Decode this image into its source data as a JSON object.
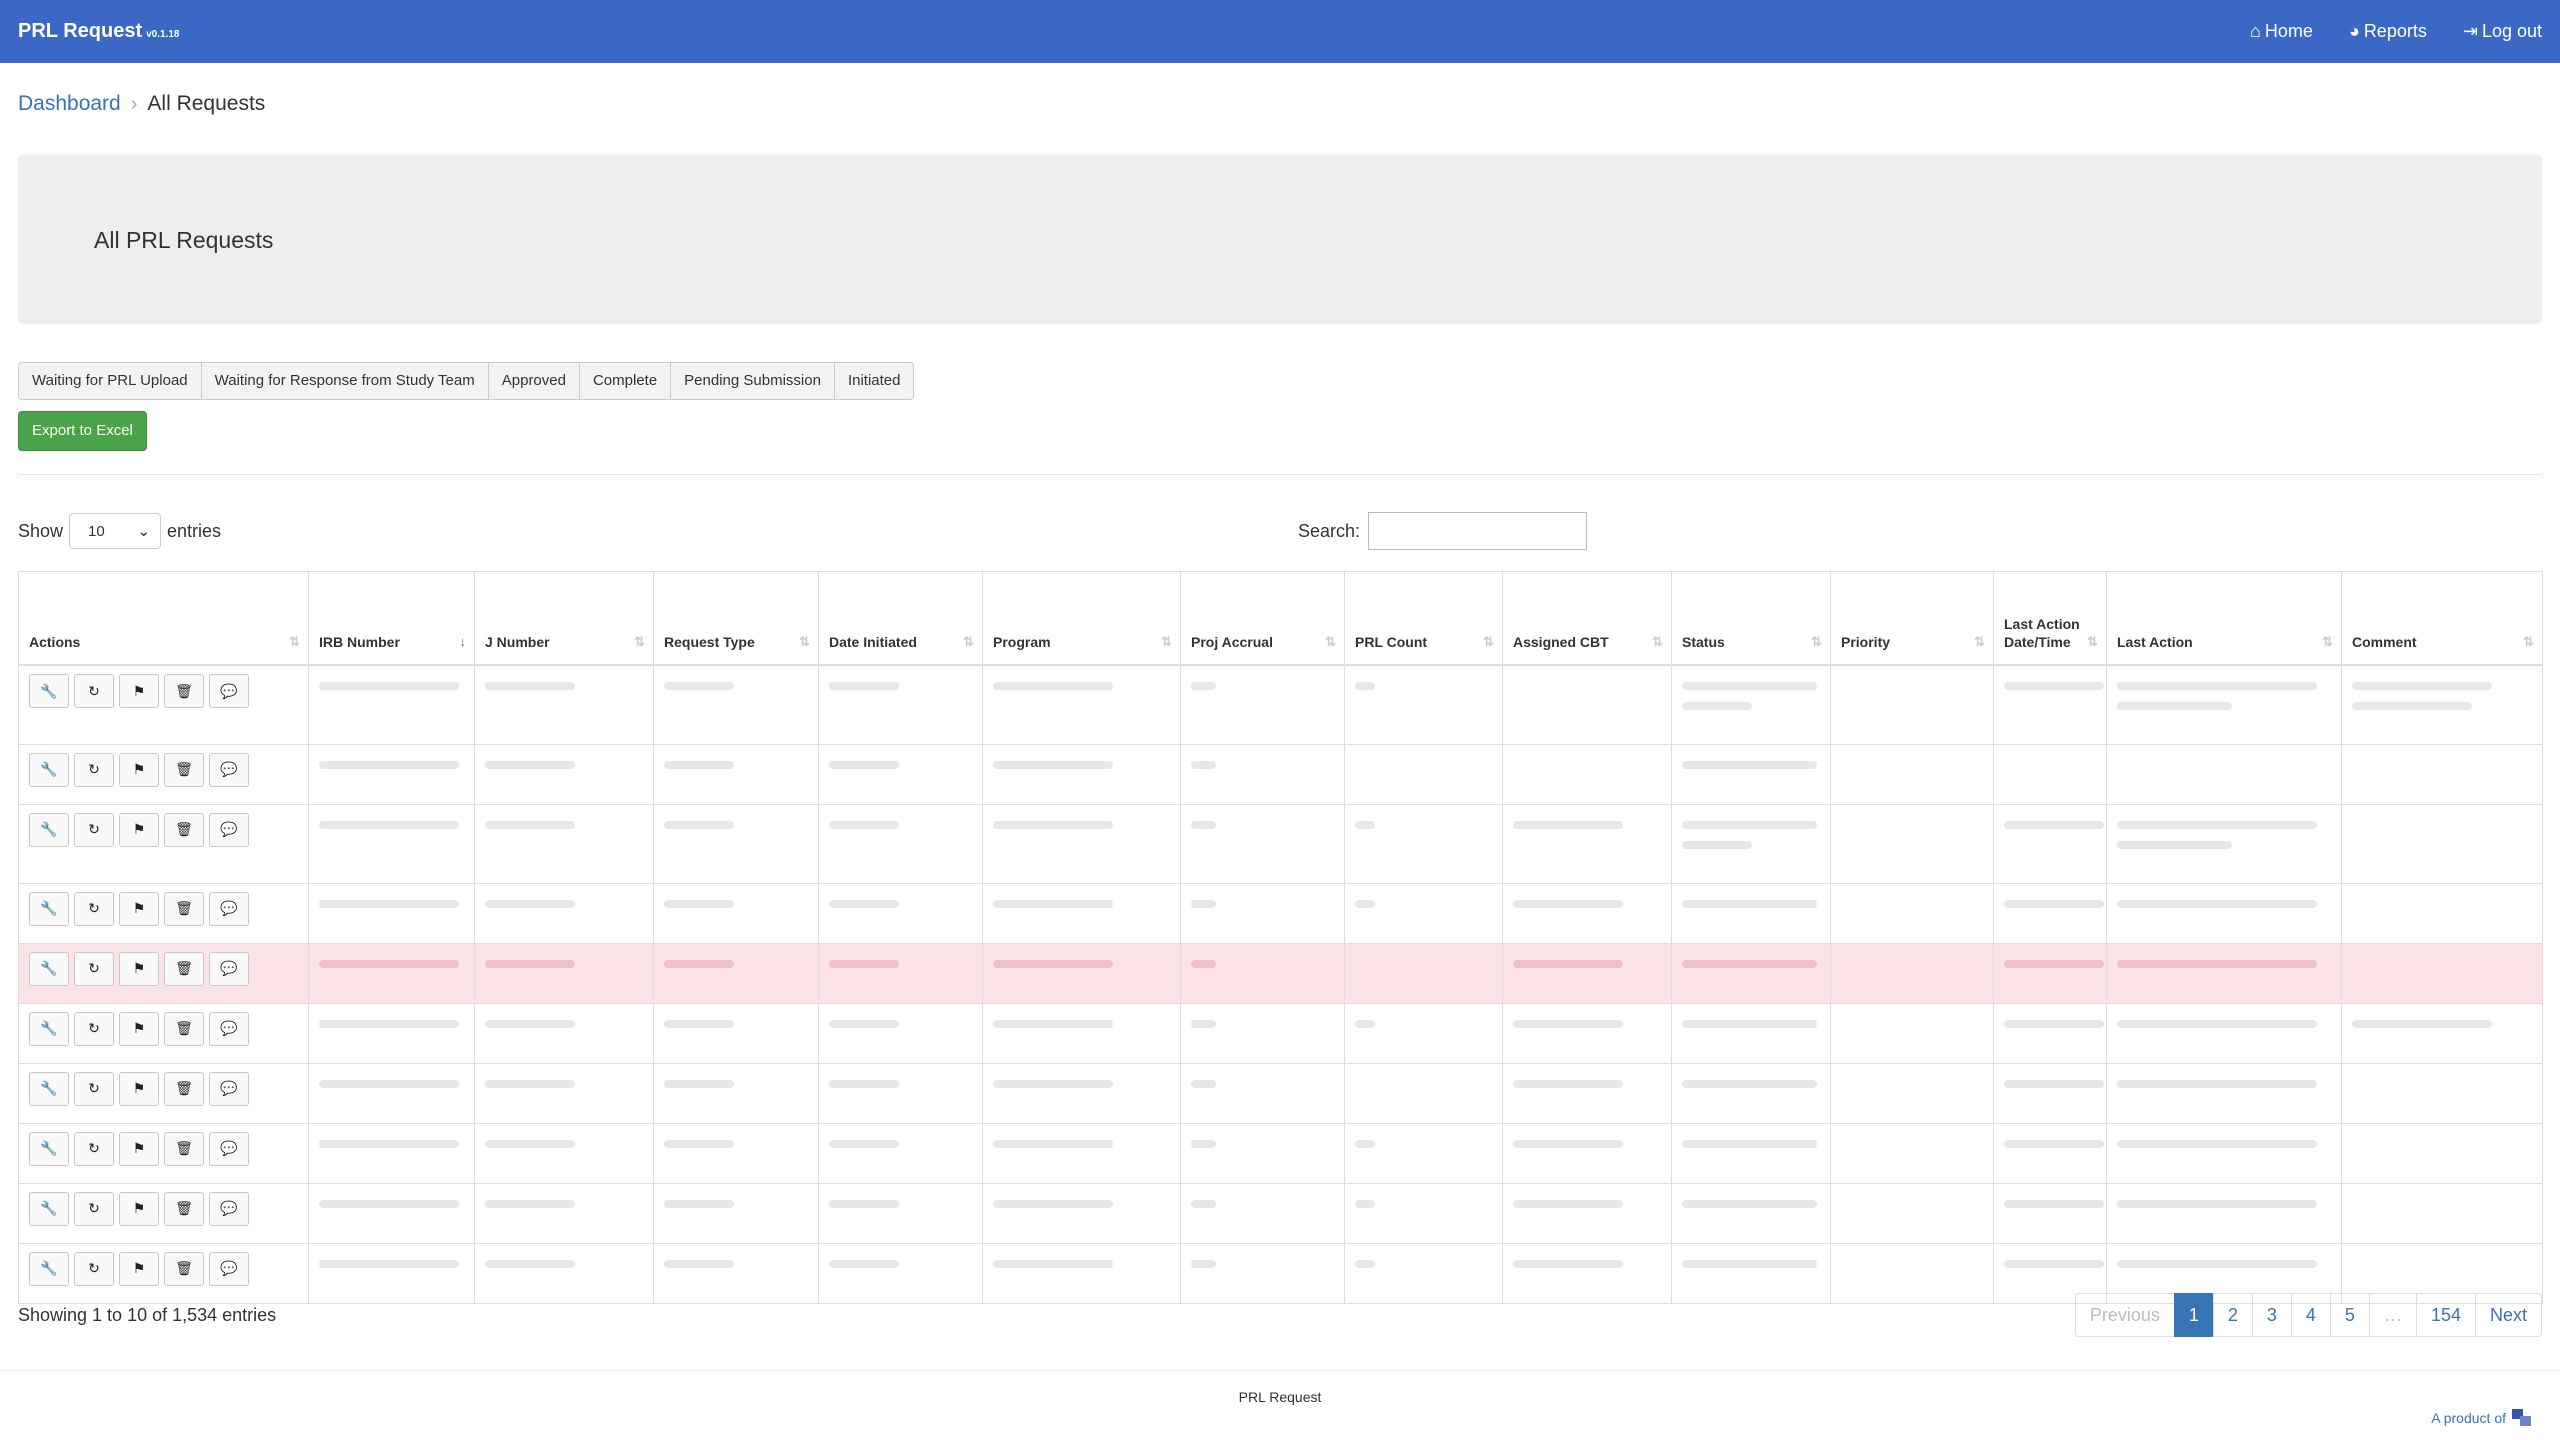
{
  "navbar": {
    "brand": "PRL Request",
    "version": "v0.1.18",
    "home": "Home",
    "reports": "Reports",
    "logout": "Log out"
  },
  "breadcrumb": {
    "parent": "Dashboard",
    "current": "All Requests"
  },
  "page": {
    "title": "All PRL Requests"
  },
  "filters": [
    "Waiting for PRL Upload",
    "Waiting for Response from Study Team",
    "Approved",
    "Complete",
    "Pending Submission",
    "Initiated"
  ],
  "export_label": "Export to Excel",
  "length": {
    "show": "Show",
    "value": "10",
    "entries": "entries"
  },
  "search": {
    "label": "Search:"
  },
  "columns": [
    {
      "label": "Actions",
      "width": 290
    },
    {
      "label": "IRB Number",
      "width": 166
    },
    {
      "label": "J Number",
      "width": 179
    },
    {
      "label": "Request Type",
      "width": 165
    },
    {
      "label": "Date Initiated",
      "width": 164
    },
    {
      "label": "Program",
      "width": 198
    },
    {
      "label": "Proj Accrual",
      "width": 164
    },
    {
      "label": "PRL Count",
      "width": 158
    },
    {
      "label": "Assigned CBT",
      "width": 169
    },
    {
      "label": "Status",
      "width": 159
    },
    {
      "label": "Priority",
      "width": 163
    },
    {
      "label": "Last Action Date/Time",
      "width": 113
    },
    {
      "label": "Last Action",
      "width": 235
    },
    {
      "label": "Comment",
      "width": 201
    }
  ],
  "info": "Showing 1 to 10 of 1,534 entries",
  "pagination": {
    "previous": "Previous",
    "pages": [
      "1",
      "2",
      "3",
      "4",
      "5"
    ],
    "ellipsis": "…",
    "last": "154",
    "next": "Next"
  },
  "footer": {
    "center": "PRL Request",
    "credit": "A product of"
  }
}
